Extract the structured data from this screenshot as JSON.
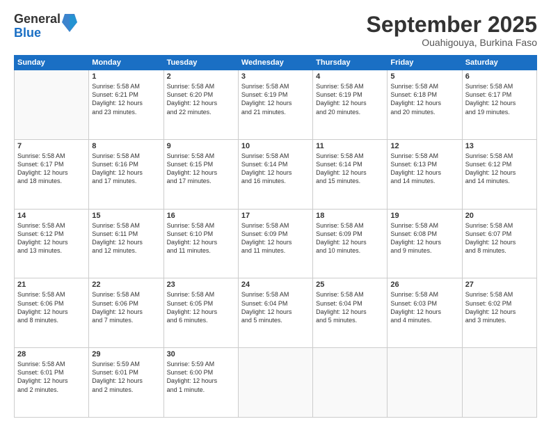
{
  "header": {
    "logo_general": "General",
    "logo_blue": "Blue",
    "month": "September 2025",
    "location": "Ouahigouya, Burkina Faso"
  },
  "days_of_week": [
    "Sunday",
    "Monday",
    "Tuesday",
    "Wednesday",
    "Thursday",
    "Friday",
    "Saturday"
  ],
  "weeks": [
    [
      {
        "day": "",
        "info": ""
      },
      {
        "day": "1",
        "info": "Sunrise: 5:58 AM\nSunset: 6:21 PM\nDaylight: 12 hours\nand 23 minutes."
      },
      {
        "day": "2",
        "info": "Sunrise: 5:58 AM\nSunset: 6:20 PM\nDaylight: 12 hours\nand 22 minutes."
      },
      {
        "day": "3",
        "info": "Sunrise: 5:58 AM\nSunset: 6:19 PM\nDaylight: 12 hours\nand 21 minutes."
      },
      {
        "day": "4",
        "info": "Sunrise: 5:58 AM\nSunset: 6:19 PM\nDaylight: 12 hours\nand 20 minutes."
      },
      {
        "day": "5",
        "info": "Sunrise: 5:58 AM\nSunset: 6:18 PM\nDaylight: 12 hours\nand 20 minutes."
      },
      {
        "day": "6",
        "info": "Sunrise: 5:58 AM\nSunset: 6:17 PM\nDaylight: 12 hours\nand 19 minutes."
      }
    ],
    [
      {
        "day": "7",
        "info": "Sunrise: 5:58 AM\nSunset: 6:17 PM\nDaylight: 12 hours\nand 18 minutes."
      },
      {
        "day": "8",
        "info": "Sunrise: 5:58 AM\nSunset: 6:16 PM\nDaylight: 12 hours\nand 17 minutes."
      },
      {
        "day": "9",
        "info": "Sunrise: 5:58 AM\nSunset: 6:15 PM\nDaylight: 12 hours\nand 17 minutes."
      },
      {
        "day": "10",
        "info": "Sunrise: 5:58 AM\nSunset: 6:14 PM\nDaylight: 12 hours\nand 16 minutes."
      },
      {
        "day": "11",
        "info": "Sunrise: 5:58 AM\nSunset: 6:14 PM\nDaylight: 12 hours\nand 15 minutes."
      },
      {
        "day": "12",
        "info": "Sunrise: 5:58 AM\nSunset: 6:13 PM\nDaylight: 12 hours\nand 14 minutes."
      },
      {
        "day": "13",
        "info": "Sunrise: 5:58 AM\nSunset: 6:12 PM\nDaylight: 12 hours\nand 14 minutes."
      }
    ],
    [
      {
        "day": "14",
        "info": "Sunrise: 5:58 AM\nSunset: 6:12 PM\nDaylight: 12 hours\nand 13 minutes."
      },
      {
        "day": "15",
        "info": "Sunrise: 5:58 AM\nSunset: 6:11 PM\nDaylight: 12 hours\nand 12 minutes."
      },
      {
        "day": "16",
        "info": "Sunrise: 5:58 AM\nSunset: 6:10 PM\nDaylight: 12 hours\nand 11 minutes."
      },
      {
        "day": "17",
        "info": "Sunrise: 5:58 AM\nSunset: 6:09 PM\nDaylight: 12 hours\nand 11 minutes."
      },
      {
        "day": "18",
        "info": "Sunrise: 5:58 AM\nSunset: 6:09 PM\nDaylight: 12 hours\nand 10 minutes."
      },
      {
        "day": "19",
        "info": "Sunrise: 5:58 AM\nSunset: 6:08 PM\nDaylight: 12 hours\nand 9 minutes."
      },
      {
        "day": "20",
        "info": "Sunrise: 5:58 AM\nSunset: 6:07 PM\nDaylight: 12 hours\nand 8 minutes."
      }
    ],
    [
      {
        "day": "21",
        "info": "Sunrise: 5:58 AM\nSunset: 6:06 PM\nDaylight: 12 hours\nand 8 minutes."
      },
      {
        "day": "22",
        "info": "Sunrise: 5:58 AM\nSunset: 6:06 PM\nDaylight: 12 hours\nand 7 minutes."
      },
      {
        "day": "23",
        "info": "Sunrise: 5:58 AM\nSunset: 6:05 PM\nDaylight: 12 hours\nand 6 minutes."
      },
      {
        "day": "24",
        "info": "Sunrise: 5:58 AM\nSunset: 6:04 PM\nDaylight: 12 hours\nand 5 minutes."
      },
      {
        "day": "25",
        "info": "Sunrise: 5:58 AM\nSunset: 6:04 PM\nDaylight: 12 hours\nand 5 minutes."
      },
      {
        "day": "26",
        "info": "Sunrise: 5:58 AM\nSunset: 6:03 PM\nDaylight: 12 hours\nand 4 minutes."
      },
      {
        "day": "27",
        "info": "Sunrise: 5:58 AM\nSunset: 6:02 PM\nDaylight: 12 hours\nand 3 minutes."
      }
    ],
    [
      {
        "day": "28",
        "info": "Sunrise: 5:58 AM\nSunset: 6:01 PM\nDaylight: 12 hours\nand 2 minutes."
      },
      {
        "day": "29",
        "info": "Sunrise: 5:59 AM\nSunset: 6:01 PM\nDaylight: 12 hours\nand 2 minutes."
      },
      {
        "day": "30",
        "info": "Sunrise: 5:59 AM\nSunset: 6:00 PM\nDaylight: 12 hours\nand 1 minute."
      },
      {
        "day": "",
        "info": ""
      },
      {
        "day": "",
        "info": ""
      },
      {
        "day": "",
        "info": ""
      },
      {
        "day": "",
        "info": ""
      }
    ]
  ]
}
